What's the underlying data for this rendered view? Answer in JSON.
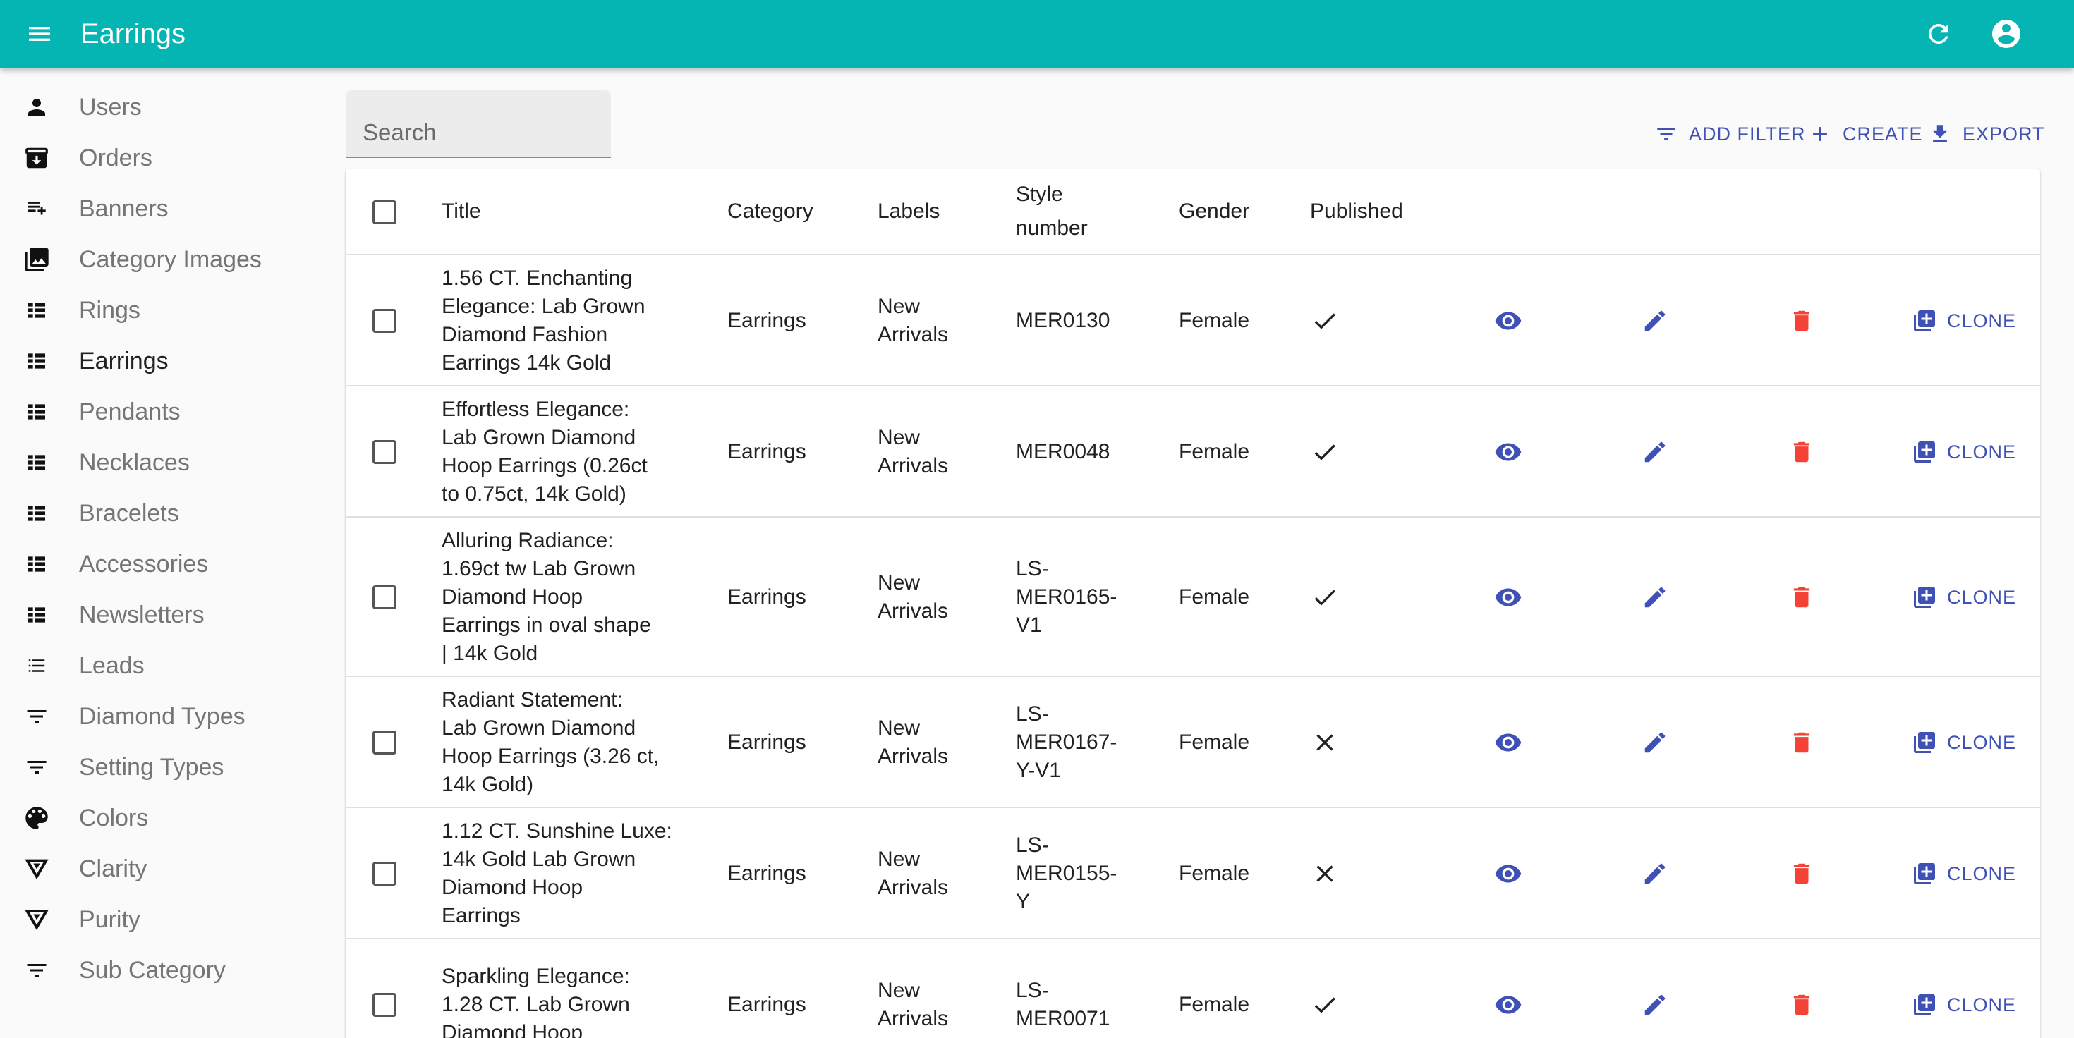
{
  "appbar": {
    "title": "Earrings",
    "color": "#05b5b3"
  },
  "sidebar": {
    "items": [
      {
        "label": "Users",
        "icon": "person-icon"
      },
      {
        "label": "Orders",
        "icon": "archive-icon"
      },
      {
        "label": "Banners",
        "icon": "playlist-add-icon"
      },
      {
        "label": "Category Images",
        "icon": "photo-library-icon"
      },
      {
        "label": "Rings",
        "icon": "view-list-icon"
      },
      {
        "label": "Earrings",
        "icon": "view-list-icon"
      },
      {
        "label": "Pendants",
        "icon": "view-list-icon"
      },
      {
        "label": "Necklaces",
        "icon": "view-list-icon"
      },
      {
        "label": "Bracelets",
        "icon": "view-list-icon"
      },
      {
        "label": "Accessories",
        "icon": "view-list-icon"
      },
      {
        "label": "Newsletters",
        "icon": "view-list-icon"
      },
      {
        "label": "Leads",
        "icon": "list-icon"
      },
      {
        "label": "Diamond Types",
        "icon": "filter-list-icon"
      },
      {
        "label": "Setting Types",
        "icon": "filter-list-icon"
      },
      {
        "label": "Colors",
        "icon": "palette-icon"
      },
      {
        "label": "Clarity",
        "icon": "change-history-icon"
      },
      {
        "label": "Purity",
        "icon": "change-history-icon"
      },
      {
        "label": "Sub Category",
        "icon": "filter-list-icon"
      }
    ],
    "active": "Earrings"
  },
  "search": {
    "placeholder": "Search",
    "value": ""
  },
  "actions": {
    "add_filter": "ADD FILTER",
    "create": "CREATE",
    "export": "EXPORT"
  },
  "table": {
    "headers": {
      "title": "Title",
      "category": "Category",
      "labels": "Labels",
      "style_line1": "Style",
      "style_line2": "number",
      "gender": "Gender",
      "published": "Published"
    },
    "clone_label": "CLONE",
    "rows": [
      {
        "title_lines": [
          "1.56 CT. Enchanting",
          "Elegance: Lab Grown",
          "Diamond Fashion",
          "Earrings 14k Gold"
        ],
        "category": "Earrings",
        "labels_lines": [
          "New",
          "Arrivals"
        ],
        "style_lines": [
          "MER0130"
        ],
        "gender": "Female",
        "published": true
      },
      {
        "title_lines": [
          "Effortless Elegance:",
          "Lab Grown Diamond",
          "Hoop Earrings (0.26ct",
          "to 0.75ct, 14k Gold)"
        ],
        "category": "Earrings",
        "labels_lines": [
          "New",
          "Arrivals"
        ],
        "style_lines": [
          "MER0048"
        ],
        "gender": "Female",
        "published": true
      },
      {
        "title_lines": [
          "Alluring Radiance:",
          "1.69ct tw Lab Grown",
          "Diamond Hoop",
          "Earrings in oval shape",
          "| 14k Gold"
        ],
        "category": "Earrings",
        "labels_lines": [
          "New",
          "Arrivals"
        ],
        "style_lines": [
          "LS-",
          "MER0165-",
          "V1"
        ],
        "gender": "Female",
        "published": true
      },
      {
        "title_lines": [
          "Radiant Statement:",
          "Lab Grown Diamond",
          "Hoop Earrings (3.26 ct,",
          "14k Gold)"
        ],
        "category": "Earrings",
        "labels_lines": [
          "New",
          "Arrivals"
        ],
        "style_lines": [
          "LS-",
          "MER0167-",
          "Y-V1"
        ],
        "gender": "Female",
        "published": false
      },
      {
        "title_lines": [
          "1.12 CT. Sunshine Luxe:",
          "14k Gold Lab Grown",
          "Diamond Hoop",
          "Earrings"
        ],
        "category": "Earrings",
        "labels_lines": [
          "New",
          "Arrivals"
        ],
        "style_lines": [
          "LS-",
          "MER0155-",
          "Y"
        ],
        "gender": "Female",
        "published": false
      },
      {
        "title_lines": [
          "Sparkling Elegance:",
          "1.28 CT. Lab Grown",
          "Diamond Hoop"
        ],
        "category": "Earrings",
        "labels_lines": [
          "New",
          "Arrivals"
        ],
        "style_lines": [
          "LS-",
          "MER0071"
        ],
        "gender": "Female",
        "published": true
      }
    ]
  },
  "colors": {
    "accent": "#3f51b5",
    "delete": "#f44336"
  }
}
